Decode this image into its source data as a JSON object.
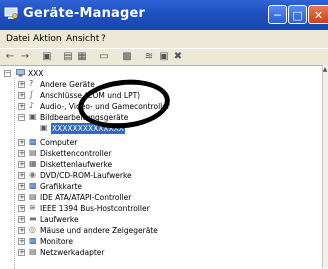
{
  "window": {
    "title": "Geräte-Manager",
    "icon": "computer-management-icon",
    "buttons": [
      "minimize-icon",
      "maximize-icon",
      "close-icon"
    ]
  },
  "menu": {
    "items": [
      "Datei",
      "Aktion",
      "Ansicht",
      "?"
    ]
  },
  "toolbar": {
    "icons": [
      "back-icon",
      "forward-icon",
      "properties-icon",
      "print-icon",
      "refresh-icon",
      "help-icon",
      "scan-hardware-icon",
      "update-driver-icon",
      "disable-icon",
      "uninstall-icon"
    ]
  },
  "tree": {
    "root": "XXX",
    "items": [
      {
        "label": "Andere Geräte",
        "icon": "question-device-icon"
      },
      {
        "label": "Anschlüsse (COM und LPT)",
        "icon": "port-icon"
      },
      {
        "label": "Audio-, Video- und Gamecontroller",
        "icon": "audio-icon"
      },
      {
        "label": "Bildbearbeitungsgeräte",
        "icon": "camera-icon"
      },
      {
        "label": "XXXXXXXXXXXXXX",
        "icon": "camera-icon"
      },
      {
        "label": "Computer",
        "icon": "computer-icon"
      },
      {
        "label": "Diskettencontroller",
        "icon": "floppy-controller-icon"
      },
      {
        "label": "Diskettenlaufwerke",
        "icon": "floppy-icon"
      },
      {
        "label": "DVD/CD-ROM-Laufwerke",
        "icon": "cdrom-icon"
      },
      {
        "label": "Grafikkarte",
        "icon": "display-adapter-icon"
      },
      {
        "label": "IDE ATA/ATAPI-Controller",
        "icon": "ide-icon"
      },
      {
        "label": "IEEE 1394 Bus-Hostcontroller",
        "icon": "firewire-icon"
      },
      {
        "label": "Laufwerke",
        "icon": "disk-icon"
      },
      {
        "label": "Mäuse und andere Zeigegeräte",
        "icon": "mouse-icon"
      },
      {
        "label": "Monitore",
        "icon": "monitor-icon"
      },
      {
        "label": "Netzwerkadapter",
        "icon": "network-icon"
      }
    ]
  }
}
